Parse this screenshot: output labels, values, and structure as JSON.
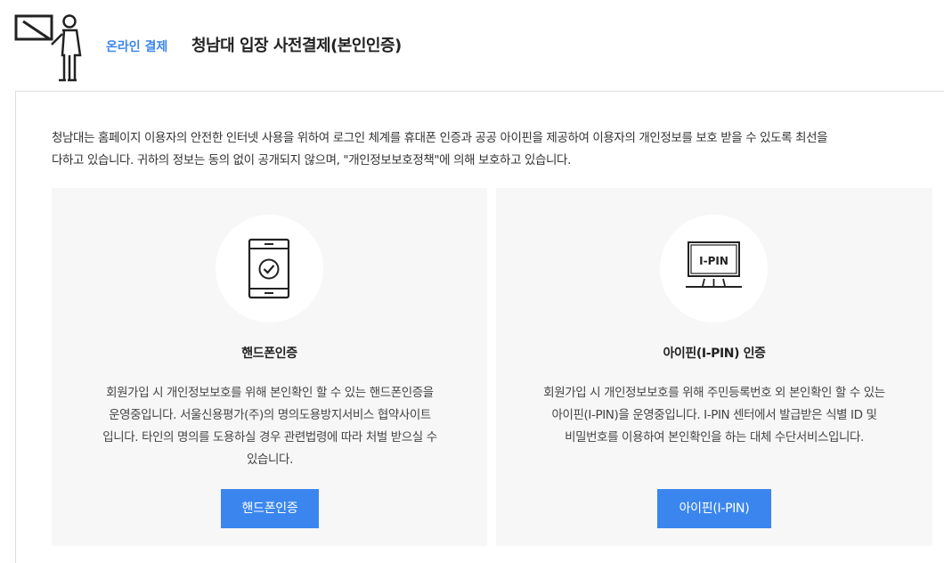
{
  "header": {
    "icon": "presenter-board-icon",
    "breadcrumb": "온라인 결제",
    "title": "청남대 입장 사전결제(본인인증)"
  },
  "intro": {
    "text": "청남대는 홈페이지 이용자의 안전한 인터넷 사용을 위하여 로그인 체계를 휴대폰 인증과 공공 아이핀을 제공하여 이용자의 개인정보를 보호 받을 수 있도록 최선을\n다하고 있습니다. 귀하의 정보는 동의 없이 공개되지 않으며, \"개인정보보호정책\"에 의해 보호하고 있습니다."
  },
  "cards": [
    {
      "icon": "smartphone-check-icon",
      "title": "핸드폰인증",
      "description": "회원가입 시 개인정보보호를 위해 본인확인 할 수 있는 핸드폰인증을\n운영중입니다. 서울신용평가(주)의 명의도용방지서비스 협약사이트\n입니다. 타인의 명의를 도용하실 경우 관련법령에 따라 처벌 받으실 수\n있습니다.",
      "button_label": "핸드폰인증"
    },
    {
      "icon": "ipin-monitor-icon",
      "icon_text": "I-PIN",
      "title": "아이핀(I-PIN) 인증",
      "description": "회원가입 시 개인정보보호를 위해 주민등록번호 외 본인확인 할 수 있는\n아이핀(I-PIN)을 운영중입니다. I-PIN 센터에서 발급받은 식별 ID 및\n비밀번호를 이용하여 본인확인을 하는 대체 수단서비스입니다.",
      "button_label": "아이핀(I-PIN)"
    }
  ],
  "colors": {
    "accent": "#3b86ee",
    "card_bg": "#f7f7f7",
    "text": "#333333"
  }
}
